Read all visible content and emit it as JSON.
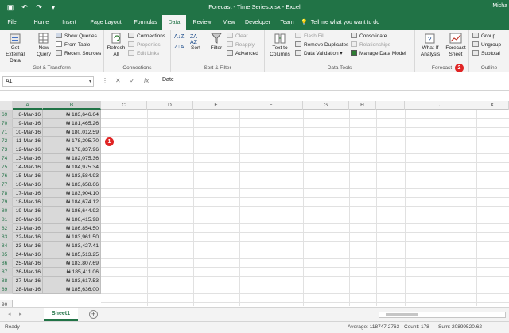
{
  "title_bar": {
    "document_title": "Forecast - Time Series.xlsx - Excel",
    "user": "Micha"
  },
  "tabs": [
    "File",
    "Home",
    "Insert",
    "Page Layout",
    "Formulas",
    "Data",
    "Review",
    "View",
    "Developer",
    "Team"
  ],
  "active_tab": "Data",
  "tell_me": "Tell me what you want to do",
  "ribbon": {
    "get_external_data": "Get External Data",
    "new_query": "New Query",
    "show_queries": "Show Queries",
    "from_table": "From Table",
    "recent_sources": "Recent Sources",
    "group_get_transform": "Get & Transform",
    "refresh_all": "Refresh All",
    "connections": "Connections",
    "properties": "Properties",
    "edit_links": "Edit Links",
    "group_connections": "Connections",
    "sort": "Sort",
    "filter": "Filter",
    "clear": "Clear",
    "reapply": "Reapply",
    "advanced": "Advanced",
    "group_sort_filter": "Sort & Filter",
    "text_to_columns": "Text to Columns",
    "flash_fill": "Flash Fill",
    "remove_duplicates": "Remove Duplicates",
    "data_validation": "Data Validation",
    "consolidate": "Consolidate",
    "relationships": "Relationships",
    "manage_data_model": "Manage Data Model",
    "group_data_tools": "Data Tools",
    "what_if": "What-If Analysis",
    "forecast_sheet": "Forecast Sheet",
    "group_forecast": "Forecast",
    "group": "Group",
    "ungroup": "Ungroup",
    "subtotal": "Subtotal",
    "group_outline": "Outline"
  },
  "formula_bar": {
    "name_box": "A1",
    "formula": "Date"
  },
  "columns": [
    "A",
    "B",
    "C",
    "D",
    "E",
    "F",
    "G",
    "H",
    "I",
    "J",
    "K"
  ],
  "rows": [
    {
      "row": "69",
      "date": "8-Mar-16",
      "value": "₦ 183,646.64"
    },
    {
      "row": "70",
      "date": "9-Mar-16",
      "value": "₦ 181,465.26"
    },
    {
      "row": "71",
      "date": "10-Mar-16",
      "value": "₦ 180,012.59"
    },
    {
      "row": "72",
      "date": "11-Mar-16",
      "value": "₦ 178,205.70"
    },
    {
      "row": "73",
      "date": "12-Mar-16",
      "value": "₦ 178,837.96"
    },
    {
      "row": "74",
      "date": "13-Mar-16",
      "value": "₦ 182,075.36"
    },
    {
      "row": "75",
      "date": "14-Mar-16",
      "value": "₦ 184,975.34"
    },
    {
      "row": "76",
      "date": "15-Mar-16",
      "value": "₦ 183,584.93"
    },
    {
      "row": "77",
      "date": "16-Mar-16",
      "value": "₦ 183,658.66"
    },
    {
      "row": "78",
      "date": "17-Mar-16",
      "value": "₦ 183,904.10"
    },
    {
      "row": "79",
      "date": "18-Mar-16",
      "value": "₦ 184,674.12"
    },
    {
      "row": "80",
      "date": "19-Mar-16",
      "value": "₦ 186,644.92"
    },
    {
      "row": "81",
      "date": "20-Mar-16",
      "value": "₦ 186,415.98"
    },
    {
      "row": "82",
      "date": "21-Mar-16",
      "value": "₦ 186,854.50"
    },
    {
      "row": "83",
      "date": "22-Mar-16",
      "value": "₦ 183,961.50"
    },
    {
      "row": "84",
      "date": "23-Mar-16",
      "value": "₦ 183,427.41"
    },
    {
      "row": "85",
      "date": "24-Mar-16",
      "value": "₦ 185,513.25"
    },
    {
      "row": "86",
      "date": "25-Mar-16",
      "value": "₦ 183,807.69"
    },
    {
      "row": "87",
      "date": "26-Mar-16",
      "value": "₦ 185,411.06"
    },
    {
      "row": "88",
      "date": "27-Mar-16",
      "value": "₦ 183,617.53"
    },
    {
      "row": "89",
      "date": "28-Mar-16",
      "value": "₦ 185,636.00"
    }
  ],
  "last_row_number": "90",
  "badges": {
    "one": "1",
    "two": "2"
  },
  "sheet_tab": "Sheet1",
  "add_sheet": "+",
  "status": {
    "ready": "Ready",
    "average": "Average: 118747.2763",
    "count": "Count: 178",
    "sum": "Sum: 20899520.62"
  },
  "colors": {
    "excel_green": "#217346",
    "badge_red": "#e02424",
    "selection_gray": "#d9d9d9"
  }
}
